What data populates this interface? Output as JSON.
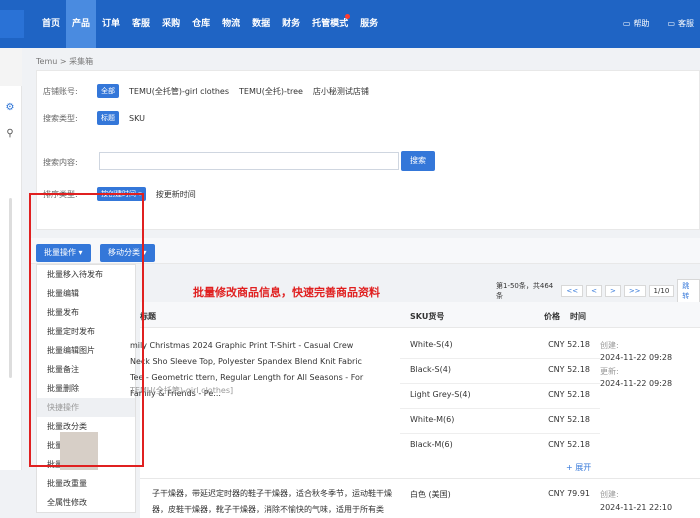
{
  "nav": {
    "items": [
      "首页",
      "产品",
      "订单",
      "客服",
      "采购",
      "仓库",
      "物流",
      "数据",
      "财务",
      "托管模式",
      "服务"
    ],
    "active_index": 1,
    "help": "帮助",
    "service": "客服"
  },
  "breadcrumb": "Temu > 采集箱",
  "filters": {
    "shop_label": "店铺账号:",
    "shop_all": "全部",
    "shops": [
      "TEMU(全托管)-girl clothes",
      "TEMU(全托)-tree",
      "店小秘测试店铺"
    ],
    "search_type_label": "搜索类型:",
    "search_type_tag": "标题",
    "search_type_opt": "SKU",
    "search_content_label": "搜索内容:",
    "search_button": "搜索",
    "sort_label": "排序类型:",
    "sort_tag": "按创建时间 ▾",
    "sort_opt": "按更新时间"
  },
  "toolbar": {
    "batch_ops": "批量操作 ▾",
    "move_category": "移动分类 ▾"
  },
  "dropdown": {
    "items_a": [
      "批量移入待发布",
      "批量编辑",
      "批量发布",
      "批量定时发布",
      "批量编辑图片",
      "批量备注",
      "批量删除"
    ],
    "section": "快捷操作",
    "items_b": [
      "批量改分类",
      "批量改供货价",
      "批量改尺寸",
      "批量改重量",
      "全属性修改"
    ]
  },
  "note": "批量修改商品信息，快速完善商品资料",
  "pager": {
    "info": "第1-50条，共464条",
    "first": "<<",
    "prev": "<",
    "next": ">",
    "last": ">>",
    "page": "1/10",
    "jump": "跳转"
  },
  "table": {
    "col_title": "标题",
    "col_sku": "SKU货号",
    "col_price": "价格",
    "col_time": "时间",
    "row1_title": "mily Christmas 2024 Graphic Print T-Shirt - Casual Crew Neck Sho Sleeve Top, Polyester Spandex Blend Knit Fabric Tee - Geometric ttern, Regular Length for All Seasons - For Family & Friends - Pe...",
    "row1_shop": "TEMU(全托管)-girl clothes]",
    "row1_skus": [
      "White-S(4)",
      "Black-S(4)",
      "Light Grey-S(4)",
      "White-M(6)",
      "Black-M(6)"
    ],
    "row1_prices": [
      "CNY 52.18",
      "CNY 52.18",
      "CNY 52.18",
      "CNY 52.18",
      "CNY 52.18"
    ],
    "created_label": "创建:",
    "created": "2024-11-22 09:28",
    "updated_label": "更新:",
    "updated": "2024-11-22 09:28",
    "expand": "+ 展开",
    "row2_title": "子干燥器，带延迟定时器的鞋子干燥器，适合秋冬季节，运动鞋干燥器，皮鞋干燥器，靴子干燥器，消除不愉快的气味，适用于所有类",
    "row2_sku": "白色 (美国)",
    "row2_price": "CNY 79.91",
    "row2_created": "2024-11-21 22:10"
  }
}
